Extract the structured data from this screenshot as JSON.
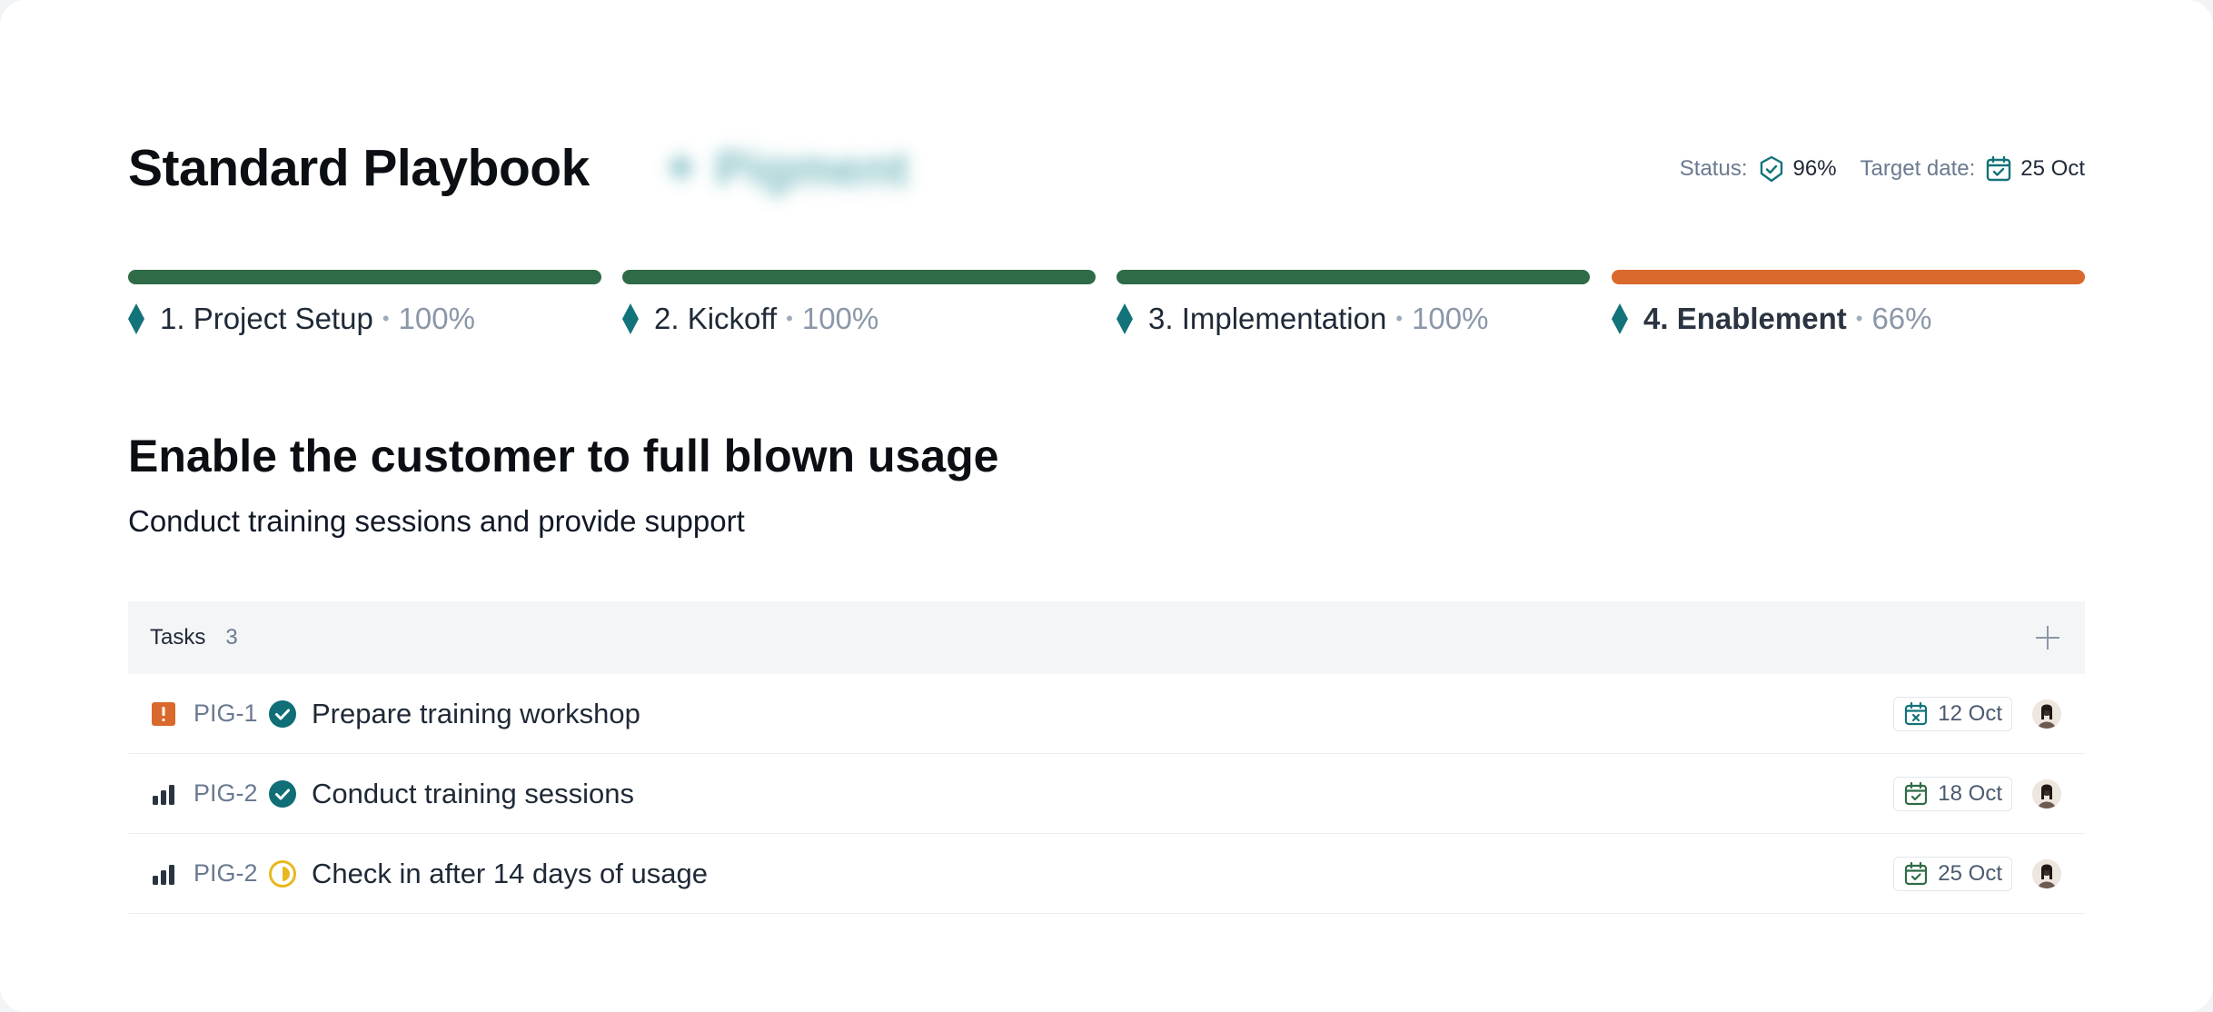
{
  "header": {
    "title": "Standard Playbook",
    "blurred_tag": "✦ Pigment",
    "status_label": "Status:",
    "status_icon": "shield-check-icon",
    "status_value": "96%",
    "target_label": "Target date:",
    "target_icon": "calendar-check-icon",
    "target_value": "25 Oct"
  },
  "colors": {
    "complete": "#2e6b46",
    "in_progress": "#d9692c",
    "teal": "#13737a",
    "priority_urgent": "#d9692c",
    "status_done": "#0f6e76",
    "status_partial": "#e8b820"
  },
  "phases": [
    {
      "label": "1. Project Setup",
      "percent": 100,
      "percent_text": "100%",
      "active": false
    },
    {
      "label": "2. Kickoff",
      "percent": 100,
      "percent_text": "100%",
      "active": false
    },
    {
      "label": "3. Implementation",
      "percent": 100,
      "percent_text": "100%",
      "active": false
    },
    {
      "label": "4. Enablement",
      "percent": 66,
      "percent_text": "66%",
      "active": true
    }
  ],
  "section": {
    "title": "Enable the customer to full blown usage",
    "subtitle": "Conduct training sessions and provide support"
  },
  "tasks": {
    "label": "Tasks",
    "count": "3",
    "add_icon": "plus-icon",
    "items": [
      {
        "priority_icon": "urgent-priority-icon",
        "id": "PIG-1",
        "status_icon": "done-check-icon",
        "title": "Prepare training workshop",
        "due_icon": "calendar-x-icon",
        "due": "12 Oct"
      },
      {
        "priority_icon": "high-priority-icon",
        "id": "PIG-2",
        "status_icon": "done-check-icon",
        "title": "Conduct training sessions",
        "due_icon": "calendar-check-icon",
        "due": "18 Oct"
      },
      {
        "priority_icon": "high-priority-icon",
        "id": "PIG-2",
        "status_icon": "half-progress-icon",
        "title": "Check in after 14 days of usage",
        "due_icon": "calendar-check-icon",
        "due": "25 Oct"
      }
    ]
  }
}
